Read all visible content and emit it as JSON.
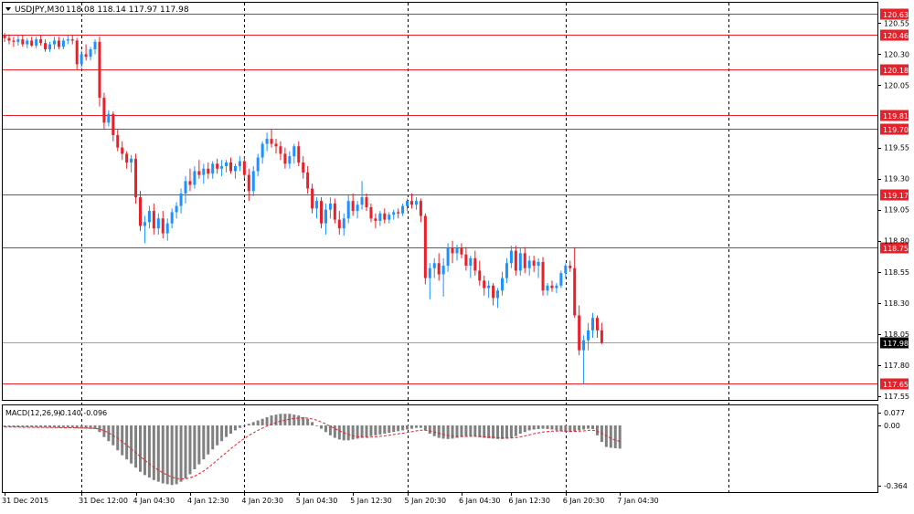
{
  "header": {
    "symbol": "USDJPY,M30",
    "ohlc": "118.08 118.14 117.97 117.98",
    "menu_icon": "triangle-down-icon"
  },
  "colors": {
    "bull": "#1E90FF",
    "bear": "#E8202A",
    "level": "#E8202A",
    "current": "#7FA6C9",
    "frame": "#000000",
    "histogram": "#808080",
    "signal": "#E8202A",
    "label_text": "#ffffff"
  },
  "chart_data": [
    {
      "type": "candlestick",
      "symbol": "USDJPY",
      "timeframe": "M30",
      "ylim": [
        117.5,
        120.68
      ],
      "y_ticks": [
        "120.55",
        "120.30",
        "120.05",
        "119.55",
        "119.30",
        "119.05",
        "118.80",
        "118.55",
        "118.30",
        "118.05",
        "117.80",
        "117.55"
      ],
      "levels": [
        "120.63",
        "120.46",
        "120.18",
        "119.81",
        "119.70",
        "119.17",
        "118.75",
        "117.65"
      ],
      "current_price": "117.98",
      "x_labels": [
        "31 Dec 2015",
        "31 Dec 12:00",
        "4 Jan 04:30",
        "4 Jan 12:30",
        "4 Jan 20:30",
        "5 Jan 04:30",
        "5 Jan 12:30",
        "5 Jan 20:30",
        "6 Jan 04:30",
        "6 Jan 12:30",
        "6 Jan 20:30",
        "7 Jan 04:30"
      ],
      "day_separators": [
        "31 Dec 12:00",
        "4 Jan 12:30",
        "5 Jan 20:30",
        "6 Jan 20:30",
        "7 Jan 12:30"
      ],
      "candles": [
        [
          120.45,
          120.47,
          120.4,
          120.43
        ],
        [
          120.43,
          120.46,
          120.38,
          120.41
        ],
        [
          120.41,
          120.44,
          120.36,
          120.4
        ],
        [
          120.4,
          120.45,
          120.37,
          120.42
        ],
        [
          120.42,
          120.45,
          120.36,
          120.38
        ],
        [
          120.38,
          120.43,
          120.35,
          120.41
        ],
        [
          120.41,
          120.44,
          120.36,
          120.37
        ],
        [
          120.37,
          120.44,
          120.35,
          120.42
        ],
        [
          120.42,
          120.45,
          120.37,
          120.39
        ],
        [
          120.39,
          120.42,
          120.32,
          120.34
        ],
        [
          120.34,
          120.4,
          120.32,
          120.38
        ],
        [
          120.38,
          120.44,
          120.34,
          120.41
        ],
        [
          120.41,
          120.44,
          120.34,
          120.36
        ],
        [
          120.36,
          120.43,
          120.34,
          120.41
        ],
        [
          120.41,
          120.45,
          120.38,
          120.42
        ],
        [
          120.42,
          120.45,
          120.38,
          120.41
        ],
        [
          120.41,
          120.43,
          120.18,
          120.22
        ],
        [
          120.22,
          120.33,
          120.19,
          120.3
        ],
        [
          120.3,
          120.38,
          120.25,
          120.28
        ],
        [
          120.28,
          120.36,
          120.25,
          120.34
        ],
        [
          120.34,
          120.42,
          120.3,
          120.4
        ],
        [
          120.4,
          120.44,
          119.88,
          119.95
        ],
        [
          119.95,
          119.99,
          119.7,
          119.75
        ],
        [
          119.75,
          119.85,
          119.72,
          119.82
        ],
        [
          119.82,
          119.84,
          119.6,
          119.65
        ],
        [
          119.65,
          119.7,
          119.52,
          119.55
        ],
        [
          119.55,
          119.6,
          119.45,
          119.5
        ],
        [
          119.5,
          119.52,
          119.38,
          119.43
        ],
        [
          119.43,
          119.49,
          119.35,
          119.46
        ],
        [
          119.46,
          119.5,
          119.1,
          119.15
        ],
        [
          119.15,
          119.2,
          118.88,
          118.92
        ],
        [
          118.92,
          119.0,
          118.78,
          118.95
        ],
        [
          118.95,
          119.08,
          118.9,
          119.04
        ],
        [
          119.04,
          119.1,
          118.85,
          118.9
        ],
        [
          118.9,
          119.02,
          118.85,
          118.98
        ],
        [
          118.98,
          119.04,
          118.82,
          118.86
        ],
        [
          118.86,
          118.98,
          118.8,
          118.94
        ],
        [
          118.94,
          119.06,
          118.9,
          119.03
        ],
        [
          119.03,
          119.11,
          118.98,
          119.08
        ],
        [
          119.08,
          119.22,
          119.02,
          119.18
        ],
        [
          119.18,
          119.32,
          119.1,
          119.28
        ],
        [
          119.28,
          119.38,
          119.2,
          119.25
        ],
        [
          119.25,
          119.4,
          119.22,
          119.36
        ],
        [
          119.36,
          119.45,
          119.3,
          119.33
        ],
        [
          119.33,
          119.42,
          119.26,
          119.38
        ],
        [
          119.38,
          119.43,
          119.3,
          119.34
        ],
        [
          119.34,
          119.44,
          119.3,
          119.42
        ],
        [
          119.42,
          119.46,
          119.34,
          119.38
        ],
        [
          119.38,
          119.45,
          119.32,
          119.4
        ],
        [
          119.4,
          119.45,
          119.35,
          119.43
        ],
        [
          119.43,
          119.47,
          119.34,
          119.36
        ],
        [
          119.36,
          119.42,
          119.3,
          119.4
        ],
        [
          119.4,
          119.48,
          119.36,
          119.44
        ],
        [
          119.44,
          119.48,
          119.3,
          119.33
        ],
        [
          119.33,
          119.38,
          119.12,
          119.2
        ],
        [
          119.2,
          119.4,
          119.16,
          119.36
        ],
        [
          119.36,
          119.5,
          119.32,
          119.47
        ],
        [
          119.47,
          119.6,
          119.42,
          119.58
        ],
        [
          119.58,
          119.67,
          119.52,
          119.62
        ],
        [
          119.62,
          119.7,
          119.55,
          119.58
        ],
        [
          119.58,
          119.62,
          119.5,
          119.56
        ],
        [
          119.56,
          119.6,
          119.45,
          119.5
        ],
        [
          119.5,
          119.55,
          119.38,
          119.42
        ],
        [
          119.42,
          119.52,
          119.38,
          119.48
        ],
        [
          119.48,
          119.58,
          119.42,
          119.56
        ],
        [
          119.56,
          119.6,
          119.4,
          119.43
        ],
        [
          119.43,
          119.48,
          119.3,
          119.35
        ],
        [
          119.35,
          119.4,
          119.18,
          119.22
        ],
        [
          119.22,
          119.26,
          119.02,
          119.06
        ],
        [
          119.06,
          119.15,
          118.98,
          119.12
        ],
        [
          119.12,
          119.15,
          118.9,
          118.94
        ],
        [
          118.94,
          119.1,
          118.85,
          119.05
        ],
        [
          119.05,
          119.15,
          118.98,
          119.1
        ],
        [
          119.1,
          119.14,
          118.94,
          118.97
        ],
        [
          118.97,
          119.04,
          118.85,
          118.9
        ],
        [
          118.9,
          119.02,
          118.84,
          118.98
        ],
        [
          118.98,
          119.17,
          118.94,
          119.12
        ],
        [
          119.12,
          119.18,
          119.0,
          119.04
        ],
        [
          119.04,
          119.12,
          118.98,
          119.09
        ],
        [
          119.09,
          119.28,
          119.05,
          119.15
        ],
        [
          119.15,
          119.18,
          119.04,
          119.07
        ],
        [
          119.07,
          119.1,
          118.95,
          118.98
        ],
        [
          118.98,
          119.02,
          118.9,
          118.96
        ],
        [
          118.96,
          119.04,
          118.92,
          119.02
        ],
        [
          119.02,
          119.06,
          118.94,
          118.97
        ],
        [
          118.97,
          119.03,
          118.94,
          119.01
        ],
        [
          119.01,
          119.05,
          118.97,
          119.03
        ],
        [
          119.03,
          119.06,
          118.98,
          119.02
        ],
        [
          119.02,
          119.1,
          119.0,
          119.08
        ],
        [
          119.08,
          119.14,
          119.04,
          119.12
        ],
        [
          119.12,
          119.18,
          119.06,
          119.09
        ],
        [
          119.09,
          119.15,
          119.05,
          119.12
        ],
        [
          119.12,
          119.14,
          118.95,
          119.0
        ],
        [
          119.0,
          119.02,
          118.45,
          118.5
        ],
        [
          118.5,
          118.62,
          118.33,
          118.58
        ],
        [
          118.58,
          118.66,
          118.5,
          118.62
        ],
        [
          118.62,
          118.7,
          118.48,
          118.53
        ],
        [
          118.53,
          118.66,
          118.35,
          118.6
        ],
        [
          118.6,
          118.78,
          118.55,
          118.74
        ],
        [
          118.74,
          118.8,
          118.62,
          118.7
        ],
        [
          118.7,
          118.77,
          118.64,
          118.74
        ],
        [
          118.74,
          118.78,
          118.66,
          118.69
        ],
        [
          118.69,
          118.75,
          118.56,
          118.6
        ],
        [
          118.6,
          118.68,
          118.5,
          118.66
        ],
        [
          118.66,
          118.72,
          118.52,
          118.56
        ],
        [
          118.56,
          118.64,
          118.44,
          118.48
        ],
        [
          118.48,
          118.52,
          118.36,
          118.42
        ],
        [
          118.42,
          118.48,
          118.34,
          118.44
        ],
        [
          118.44,
          118.46,
          118.28,
          118.34
        ],
        [
          118.34,
          118.42,
          118.26,
          118.4
        ],
        [
          118.4,
          118.55,
          118.36,
          118.5
        ],
        [
          118.5,
          118.66,
          118.46,
          118.62
        ],
        [
          118.62,
          118.76,
          118.58,
          118.72
        ],
        [
          118.72,
          118.76,
          118.52,
          118.56
        ],
        [
          118.56,
          118.74,
          118.52,
          118.7
        ],
        [
          118.7,
          118.75,
          118.54,
          118.58
        ],
        [
          118.58,
          118.68,
          118.52,
          118.64
        ],
        [
          118.64,
          118.68,
          118.55,
          118.6
        ],
        [
          118.6,
          118.66,
          118.5,
          118.63
        ],
        [
          118.63,
          118.67,
          118.36,
          118.4
        ],
        [
          118.4,
          118.46,
          118.36,
          118.44
        ],
        [
          118.44,
          118.48,
          118.39,
          118.42
        ],
        [
          118.42,
          118.46,
          118.38,
          118.44
        ],
        [
          118.44,
          118.56,
          118.42,
          118.54
        ],
        [
          118.54,
          118.62,
          118.5,
          118.6
        ],
        [
          118.6,
          118.64,
          118.55,
          118.58
        ],
        [
          118.58,
          118.75,
          118.18,
          118.2
        ],
        [
          118.2,
          118.28,
          117.88,
          117.92
        ],
        [
          117.92,
          118.04,
          117.65,
          118.0
        ],
        [
          118.0,
          118.14,
          117.92,
          118.08
        ],
        [
          118.08,
          118.22,
          118.02,
          118.18
        ],
        [
          118.18,
          118.2,
          118.02,
          118.08
        ],
        [
          118.08,
          118.14,
          117.97,
          117.98
        ]
      ]
    },
    {
      "type": "bar",
      "indicator": "MACD(12,26,9)",
      "label": "MACD(12,26,9)",
      "values_text": "-0.140 -0.096",
      "ylim": [
        -0.364,
        0.077
      ],
      "y_ticks": [
        "0.077",
        "0.00",
        "-0.364"
      ],
      "histogram": [
        -0.01,
        -0.01,
        -0.011,
        -0.011,
        -0.012,
        -0.012,
        -0.012,
        -0.013,
        -0.013,
        -0.014,
        -0.014,
        -0.014,
        -0.015,
        -0.015,
        -0.015,
        -0.015,
        -0.018,
        -0.019,
        -0.02,
        -0.021,
        -0.022,
        -0.04,
        -0.07,
        -0.095,
        -0.12,
        -0.15,
        -0.18,
        -0.205,
        -0.23,
        -0.255,
        -0.28,
        -0.3,
        -0.315,
        -0.33,
        -0.34,
        -0.35,
        -0.355,
        -0.36,
        -0.355,
        -0.34,
        -0.32,
        -0.295,
        -0.265,
        -0.235,
        -0.205,
        -0.175,
        -0.145,
        -0.12,
        -0.095,
        -0.07,
        -0.05,
        -0.03,
        -0.015,
        0.0,
        0.01,
        0.02,
        0.03,
        0.04,
        0.05,
        0.06,
        0.065,
        0.07,
        0.07,
        0.07,
        0.065,
        0.06,
        0.05,
        0.04,
        0.02,
        0.0,
        -0.02,
        -0.04,
        -0.06,
        -0.075,
        -0.085,
        -0.09,
        -0.09,
        -0.085,
        -0.08,
        -0.075,
        -0.07,
        -0.065,
        -0.06,
        -0.055,
        -0.05,
        -0.045,
        -0.04,
        -0.035,
        -0.03,
        -0.025,
        -0.02,
        -0.015,
        -0.015,
        -0.03,
        -0.05,
        -0.065,
        -0.075,
        -0.08,
        -0.082,
        -0.08,
        -0.075,
        -0.07,
        -0.065,
        -0.065,
        -0.068,
        -0.072,
        -0.075,
        -0.078,
        -0.08,
        -0.082,
        -0.082,
        -0.08,
        -0.075,
        -0.065,
        -0.05,
        -0.04,
        -0.03,
        -0.025,
        -0.022,
        -0.02,
        -0.022,
        -0.025,
        -0.03,
        -0.035,
        -0.04,
        -0.04,
        -0.035,
        -0.03,
        -0.025,
        -0.02,
        -0.022,
        -0.06,
        -0.1,
        -0.13,
        -0.135,
        -0.138,
        -0.14
      ],
      "signal": [
        -0.01,
        -0.01,
        -0.01,
        -0.01,
        -0.011,
        -0.011,
        -0.011,
        -0.012,
        -0.012,
        -0.012,
        -0.013,
        -0.013,
        -0.013,
        -0.014,
        -0.014,
        -0.014,
        -0.015,
        -0.015,
        -0.016,
        -0.017,
        -0.018,
        -0.022,
        -0.032,
        -0.045,
        -0.06,
        -0.078,
        -0.098,
        -0.12,
        -0.142,
        -0.165,
        -0.188,
        -0.21,
        -0.232,
        -0.252,
        -0.27,
        -0.286,
        -0.3,
        -0.312,
        -0.32,
        -0.323,
        -0.322,
        -0.316,
        -0.306,
        -0.292,
        -0.275,
        -0.255,
        -0.233,
        -0.21,
        -0.187,
        -0.164,
        -0.141,
        -0.119,
        -0.098,
        -0.079,
        -0.061,
        -0.045,
        -0.03,
        -0.016,
        -0.004,
        0.007,
        0.017,
        0.025,
        0.032,
        0.038,
        0.042,
        0.044,
        0.045,
        0.044,
        0.039,
        0.031,
        0.021,
        0.009,
        -0.005,
        -0.019,
        -0.032,
        -0.044,
        -0.054,
        -0.062,
        -0.068,
        -0.071,
        -0.072,
        -0.071,
        -0.069,
        -0.066,
        -0.063,
        -0.059,
        -0.055,
        -0.051,
        -0.047,
        -0.042,
        -0.038,
        -0.033,
        -0.029,
        -0.029,
        -0.033,
        -0.04,
        -0.047,
        -0.054,
        -0.06,
        -0.064,
        -0.066,
        -0.067,
        -0.067,
        -0.066,
        -0.066,
        -0.067,
        -0.069,
        -0.071,
        -0.072,
        -0.074,
        -0.076,
        -0.077,
        -0.076,
        -0.074,
        -0.069,
        -0.063,
        -0.057,
        -0.05,
        -0.045,
        -0.04,
        -0.037,
        -0.035,
        -0.034,
        -0.034,
        -0.035,
        -0.036,
        -0.036,
        -0.035,
        -0.033,
        -0.03,
        -0.029,
        -0.035,
        -0.048,
        -0.064,
        -0.078,
        -0.09,
        -0.096
      ]
    }
  ]
}
